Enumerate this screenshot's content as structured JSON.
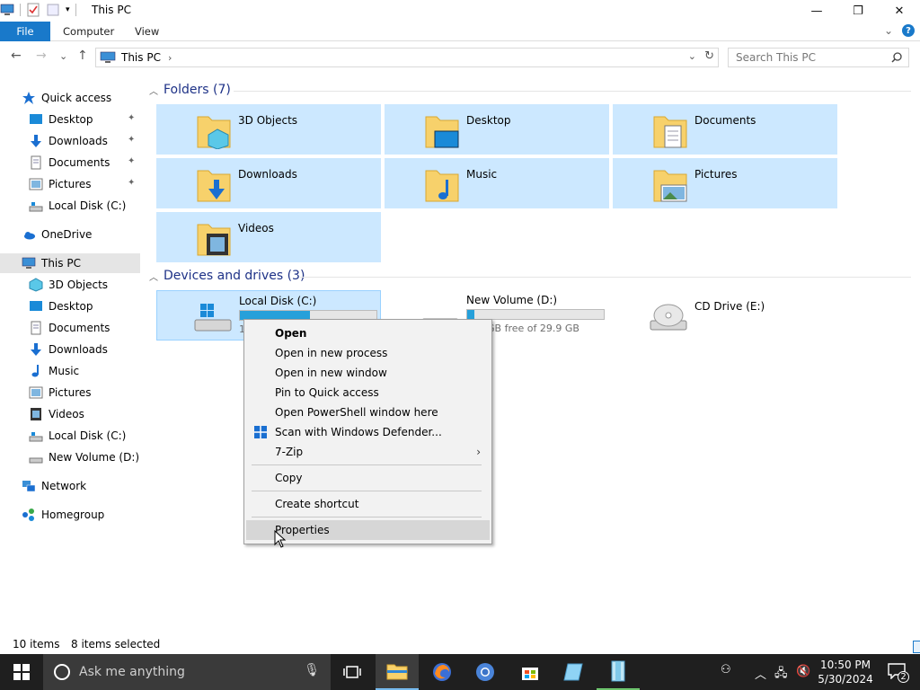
{
  "window": {
    "title": "This PC",
    "controls": {
      "minimize": "—",
      "maximize": "❐",
      "close": "✕"
    }
  },
  "ribbon": {
    "tabs": {
      "file": "File",
      "computer": "Computer",
      "view": "View"
    },
    "expand": "⌄",
    "help": "?"
  },
  "address": {
    "crumb": "This PC",
    "crumb_arrow": "›",
    "dropdown": "⌄",
    "refresh": "↻"
  },
  "nav": {
    "back": "←",
    "forward": "→",
    "recent": "⌄",
    "up": "↑"
  },
  "search": {
    "placeholder": "Search This PC",
    "icon": "search-icon"
  },
  "sidebar": {
    "quick_access": "Quick access",
    "quick_items": [
      "Desktop",
      "Downloads",
      "Documents",
      "Pictures",
      "Local Disk (C:)"
    ],
    "onedrive": "OneDrive",
    "this_pc": "This PC",
    "pc_items": [
      "3D Objects",
      "Desktop",
      "Documents",
      "Downloads",
      "Music",
      "Pictures",
      "Videos",
      "Local Disk (C:)",
      "New Volume (D:)"
    ],
    "network": "Network",
    "homegroup": "Homegroup",
    "pin_glyph": "📌"
  },
  "folders": {
    "header": "Folders (7)",
    "items": [
      "3D Objects",
      "Desktop",
      "Documents",
      "Downloads",
      "Music",
      "Pictures",
      "Videos"
    ]
  },
  "devices": {
    "header": "Devices and drives (3)",
    "drives": [
      {
        "label": "Local Disk (C:)",
        "free": "1",
        "used_fraction": 0.51
      },
      {
        "label": "New Volume (D:)",
        "free": "GB free of 29.9 GB",
        "used_fraction": 0.05
      },
      {
        "label": "CD Drive (E:)"
      }
    ]
  },
  "context_menu": {
    "items": {
      "open": "Open",
      "open_new_process": "Open in new process",
      "open_new_window": "Open in new window",
      "pin_quick": "Pin to Quick access",
      "powershell": "Open PowerShell window here",
      "defender": "Scan with Windows Defender...",
      "zip": "7-Zip",
      "copy": "Copy",
      "shortcut": "Create shortcut",
      "properties": "Properties"
    },
    "submenu_arrow": "›"
  },
  "status": {
    "items": "10 items",
    "selected": "8 items selected"
  },
  "taskbar": {
    "search_placeholder": "Ask me anything",
    "time": "10:50 PM",
    "date": "5/30/2024",
    "notification_count": "2"
  }
}
